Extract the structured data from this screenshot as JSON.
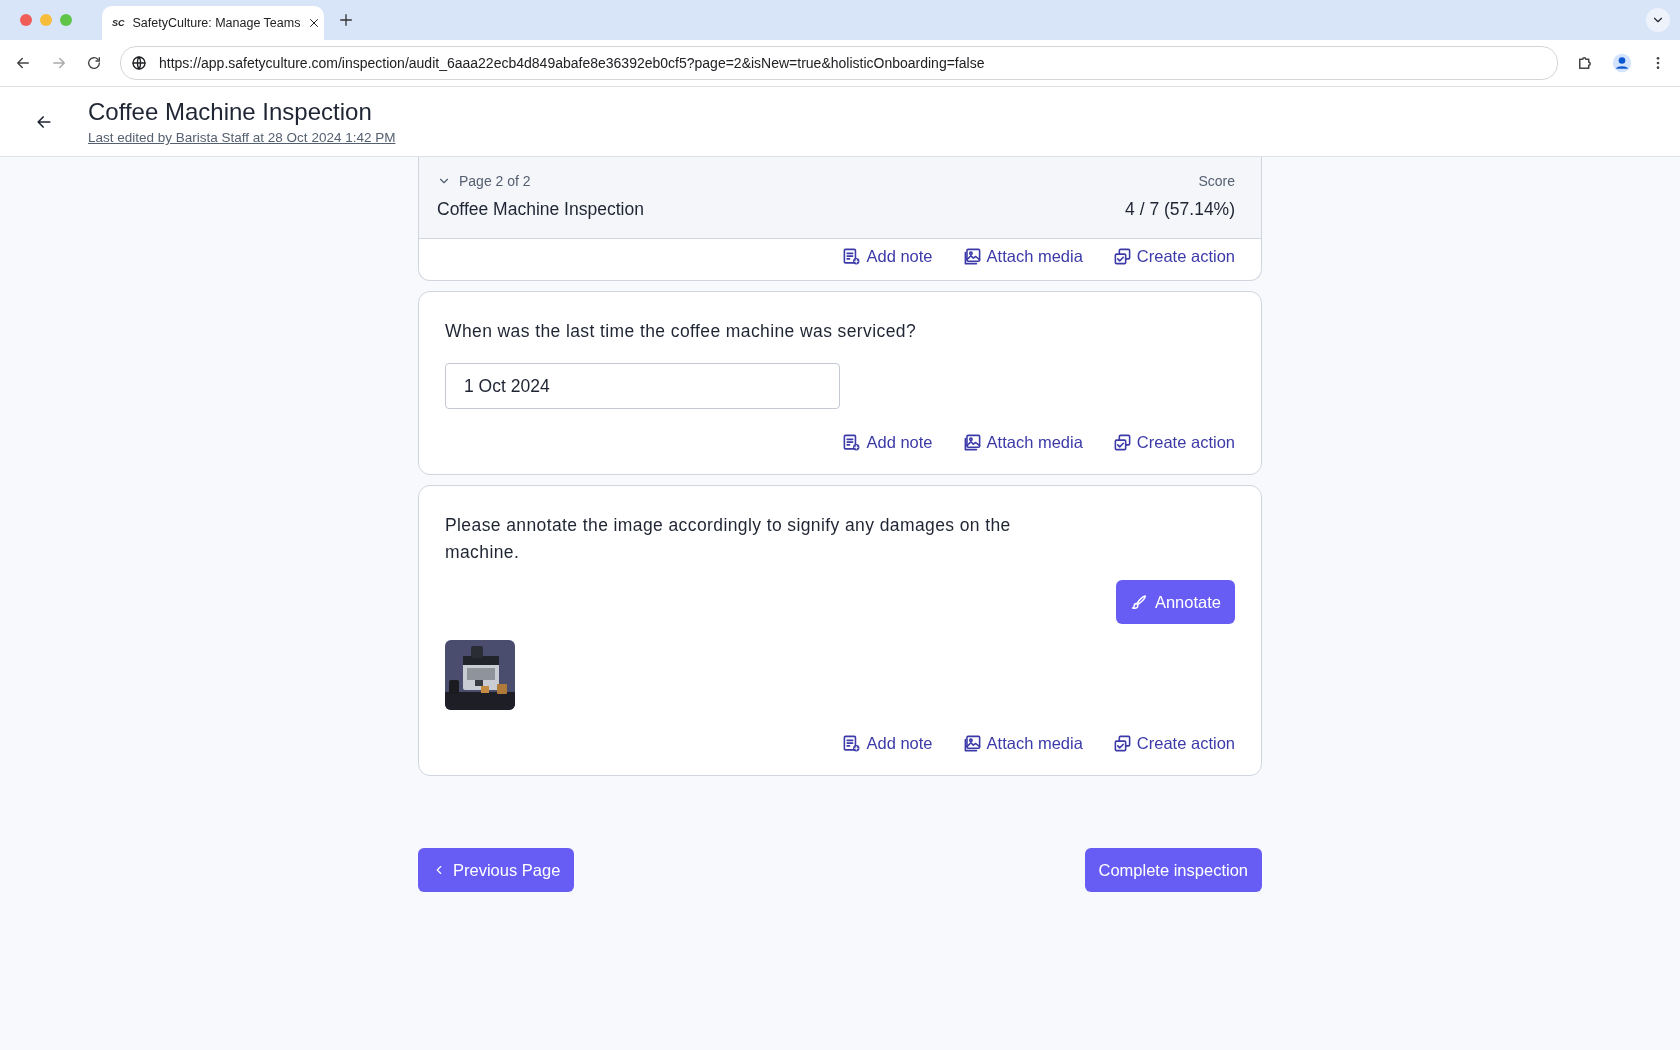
{
  "browser": {
    "tab": {
      "title": "SafetyCulture: Manage Teams",
      "favicon": "SC"
    },
    "url": "https://app.safetyculture.com/inspection/audit_6aaa22ecb4d849abafe8e36392eb0cf5?page=2&isNew=true&holisticOnboarding=false"
  },
  "header": {
    "title": "Coffee Machine Inspection",
    "subtitle": "Last edited by Barista Staff at 28 Oct 2024 1:42 PM"
  },
  "page_header": {
    "page": "Page 2 of 2",
    "expanded": true,
    "title": "Coffee Machine Inspection",
    "score_label": "Score",
    "score": "4 / 7 (57.14%)"
  },
  "cards": [
    {
      "kind": "stub",
      "actions": [
        {
          "kind": "note",
          "label": "Add note"
        },
        {
          "kind": "media",
          "label": "Attach media"
        },
        {
          "kind": "action",
          "label": "Create action"
        }
      ]
    },
    {
      "kind": "date",
      "question": "When was the last time the coffee machine was serviced?",
      "value": "1 Oct 2024",
      "actions": [
        {
          "kind": "note",
          "label": "Add note"
        },
        {
          "kind": "media",
          "label": "Attach media"
        },
        {
          "kind": "action",
          "label": "Create action"
        }
      ]
    },
    {
      "kind": "annotate",
      "question": "Please annotate the image accordingly to signify any damages on the machine.",
      "button": "Annotate",
      "actions": [
        {
          "kind": "note",
          "label": "Add note"
        },
        {
          "kind": "media",
          "label": "Attach media"
        },
        {
          "kind": "action",
          "label": "Create action"
        }
      ]
    }
  ],
  "footer": {
    "previous": "Previous Page",
    "complete": "Complete inspection"
  }
}
